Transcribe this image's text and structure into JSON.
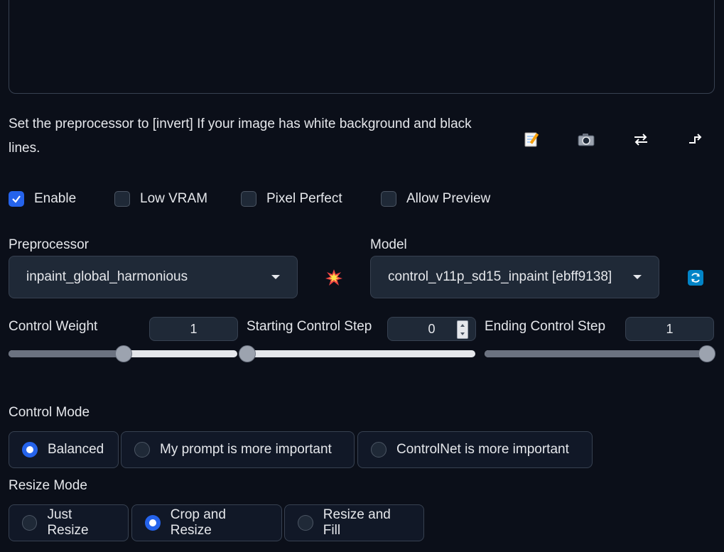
{
  "note": "Set the preprocessor to [invert] If your image has white background and black lines.",
  "tools": [
    {
      "name": "edit-icon",
      "glyph": "📝"
    },
    {
      "name": "camera-icon",
      "glyph": "📷"
    },
    {
      "name": "swap-icon",
      "glyph": "⇄"
    },
    {
      "name": "send-icon",
      "glyph": "↵"
    }
  ],
  "checkboxes": [
    {
      "label": "Enable",
      "checked": true
    },
    {
      "label": "Low VRAM",
      "checked": false
    },
    {
      "label": "Pixel Perfect",
      "checked": false
    },
    {
      "label": "Allow Preview",
      "checked": false
    }
  ],
  "preprocessor": {
    "label": "Preprocessor",
    "value": "inpaint_global_harmonious"
  },
  "model": {
    "label": "Model",
    "value": "control_v11p_sd15_inpaint [ebff9138]"
  },
  "colors": {
    "accent": "#2563eb",
    "background": "#0b0f19",
    "panel": "#1f2937",
    "border": "#374151"
  },
  "sliders": [
    {
      "label": "Control Weight",
      "value": "1",
      "fraction": 0.5
    },
    {
      "label": "Starting Control Step",
      "value": "0",
      "fraction": 0.0
    },
    {
      "label": "Ending Control Step",
      "value": "1",
      "fraction": 1.0
    }
  ],
  "control_mode": {
    "label": "Control Mode",
    "options": [
      "Balanced",
      "My prompt is more important",
      "ControlNet is more important"
    ],
    "selected": 0
  },
  "resize_mode": {
    "label": "Resize Mode",
    "options": [
      "Just Resize",
      "Crop and Resize",
      "Resize and Fill"
    ],
    "selected": 1
  }
}
